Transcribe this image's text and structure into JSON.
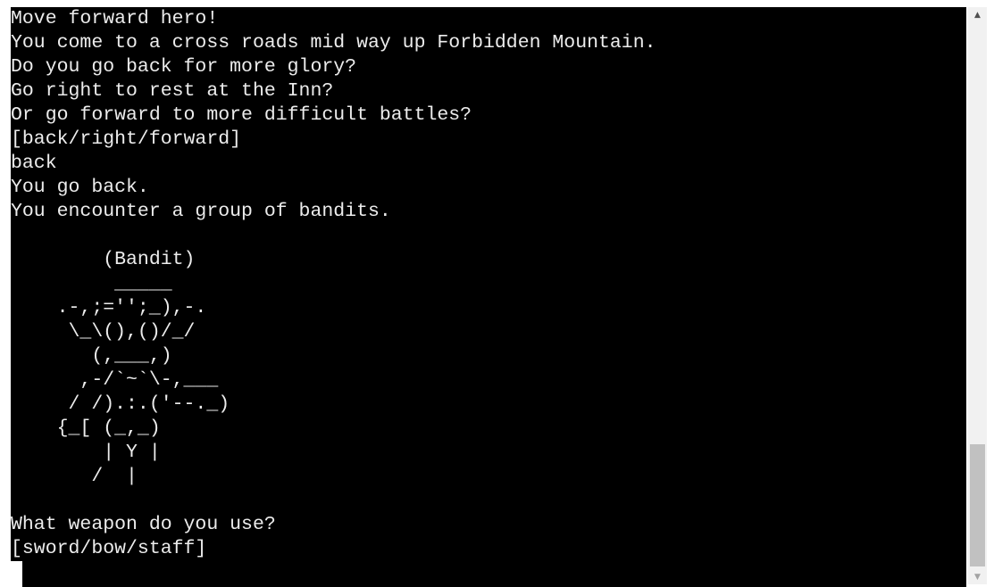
{
  "terminal": {
    "lines": [
      "Move forward hero!",
      "You come to a cross roads mid way up Forbidden Mountain.",
      "Do you go back for more glory?",
      "Go right to rest at the Inn?",
      "Or go forward to more difficult battles?",
      "[back/right/forward]",
      "back",
      "You go back.",
      "You encounter a group of bandits.",
      "",
      "        (Bandit)",
      "         _____",
      "    .-,;='';_),-.",
      "     \\_\\(),()/_/",
      "       (,___,)",
      "      ,-/`~`\\-,___",
      "     / /).:.('--._)",
      "    {_[ (_,_)",
      "        | Y |",
      "       /  |",
      "",
      "What weapon do you use?",
      "[sword/bow/staff]"
    ]
  },
  "scrollbar": {
    "up_icon": "triangle-up-icon",
    "down_icon": "triangle-down-icon",
    "up_glyph": "▲",
    "down_glyph": "▼",
    "scroll_position": 0.98
  }
}
